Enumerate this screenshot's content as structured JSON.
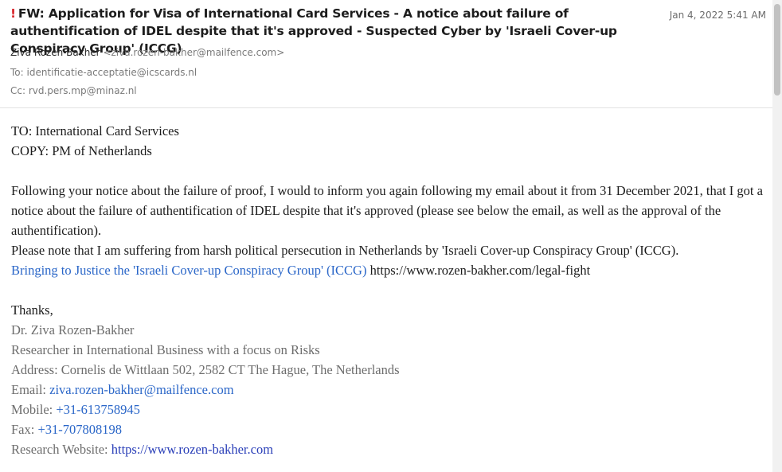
{
  "email": {
    "importance_icon": "!",
    "subject": "FW: Application for Visa of International Card Services - A notice about failure of authentification of IDEL despite that it's approved - Suspected Cyber by 'Israeli Cover-up Conspiracy Group' (ICCG)",
    "date": "Jan 4, 2022 5:41 AM",
    "from_name": "Ziva Rozen-Bakher",
    "from_address": "<ziva.rozen-bakher@mailfence.com>",
    "to": "To: identificatie-acceptatie@icscards.nl",
    "cc": "Cc: rvd.pers.mp@minaz.nl"
  },
  "body": {
    "line_to": "TO: International Card Services",
    "line_copy": "COPY: PM of Netherlands",
    "para1": "Following your notice about the failure of proof, I would to inform you again following my email about it from 31 December 2021, that I got a notice about the failure of authentification of IDEL despite that it's approved (please see below the email, as well as the approval of the authentification).",
    "para2": "Please note that I am suffering from harsh political persecution in Netherlands by 'Israeli Cover-up Conspiracy Group' (ICCG).",
    "link_text": "Bringing to Justice the 'Israeli Cover-up Conspiracy Group' (ICCG)",
    "link_url_text": " https://www.rozen-bakher.com/legal-fight",
    "thanks": "Thanks,",
    "sig_name": "Dr. Ziva Rozen-Bakher",
    "sig_title": "Researcher in International Business with a focus on Risks",
    "sig_address": "Address: Cornelis de Wittlaan 502, 2582 CT The Hague, The Netherlands",
    "sig_email_label": "Email: ",
    "sig_email": "ziva.rozen-bakher@mailfence.com",
    "sig_mobile_label": "Mobile: ",
    "sig_mobile": "+31-613758945",
    "sig_fax_label": "Fax: ",
    "sig_fax": "+31-707808198",
    "sig_web_label": "Research Website: ",
    "sig_web": "https://www.rozen-bakher.com"
  },
  "colors": {
    "link": "#2a66c8",
    "importance": "#d7262b"
  }
}
